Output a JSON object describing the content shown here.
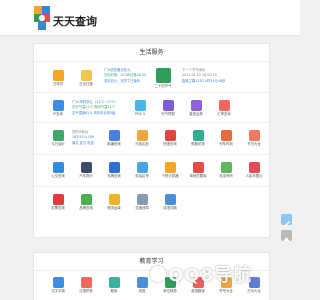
{
  "header": {
    "logo_text": "天天查询"
  },
  "life": {
    "title": "生活服务",
    "calendar": {
      "label": "万年历",
      "solar": "2023.02.18",
      "lunar_line": "广州农历腊月初九",
      "day_line": "农历初九 星期六",
      "extra_line": "宜：嫁娶 祭祀"
    },
    "rows": [
      [
        {
          "label": "万年历",
          "color": "#f5a623"
        },
        {
          "label": "日出日落",
          "color": "#f3c54a"
        },
        {
          "label": "二十四节气",
          "color": "#2f9e5b"
        }
      ]
    ],
    "info_calendar": [
      "广州农历腊月初九",
      "日出时间：07:09日落18:32",
      "农历初九 · 农历丁巳兔年"
    ],
    "info_jieqi": [
      "下一个节气雨水",
      "2023.02.19 16:00:18",
      "距离立春12天14时34分40秒"
    ],
    "weather_info": [
      "广州 晴转多云（11℃~21℃）",
      "白天气温21℃ 夜间气温11℃",
      "空气湿度62% 风向东北风3级"
    ],
    "ip_info": [
      "您的IP地址",
      "183.93.0.189",
      "湖北 武汉 电信"
    ],
    "grid1": [
      {
        "label": "IP查询",
        "color": "#3a8ee6"
      },
      {
        "label": "PM2.5",
        "color": "#46b5f0"
      },
      {
        "label": "天气预报",
        "color": "#7c5cd6"
      },
      {
        "label": "星座运势",
        "color": "#8f60e0"
      },
      {
        "label": "汇率查询",
        "color": "#f2675c"
      }
    ],
    "grid2": [
      {
        "label": "今日油价",
        "color": "#3ea86a"
      },
      {
        "label": "邮编查询",
        "color": "#4a7ee0"
      },
      {
        "label": "行政区划",
        "color": "#f0a63a"
      },
      {
        "label": "快递查询",
        "color": "#e3453c"
      },
      {
        "label": "假期安排",
        "color": "#2fb08f"
      },
      {
        "label": "列车时刻",
        "color": "#e96a3b"
      },
      {
        "label": "节日大全",
        "color": "#f27a5e"
      }
    ],
    "grid3": [
      {
        "label": "公交查询",
        "color": "#2f8ee0"
      },
      {
        "label": "汽车报价",
        "color": "#3e4d66"
      },
      {
        "label": "车牌查询",
        "color": "#2d6fd2"
      },
      {
        "label": "电话区号",
        "color": "#46a7e8"
      },
      {
        "label": "个税计算器",
        "color": "#f5a623"
      },
      {
        "label": "驾驶员题库",
        "color": "#e84a4a"
      },
      {
        "label": "电话号码",
        "color": "#5cb85c"
      },
      {
        "label": "人民币图片",
        "color": "#e34c52"
      }
    ],
    "grid4": [
      {
        "label": "彩票查询",
        "color": "#e03b3b"
      },
      {
        "label": "品牌查询",
        "color": "#4caf50"
      },
      {
        "label": "物流运单",
        "color": "#f0b429"
      },
      {
        "label": "交通违章",
        "color": "#8a9bb0"
      },
      {
        "label": "成语词典",
        "color": "#4a90d9"
      }
    ]
  },
  "edu": {
    "title": "教育学习",
    "grid": [
      {
        "label": "汉字字典",
        "color": "#3c8ee0"
      },
      {
        "label": "汉语拼音",
        "color": "#f2675c"
      },
      {
        "label": "题库",
        "color": "#37b3a2"
      },
      {
        "label": "成语",
        "color": "#4a90d9"
      },
      {
        "label": "单位换算",
        "color": "#2f9e5b"
      },
      {
        "label": "英语翻译",
        "color": "#e8625a"
      },
      {
        "label": "符号大全",
        "color": "#f2a541"
      },
      {
        "label": "古诗大全",
        "color": "#5b7fd6"
      }
    ]
  },
  "watermark": "QQ8导航",
  "colors": {
    "accent": "#3b82d8",
    "background": "#f1f1f1"
  }
}
